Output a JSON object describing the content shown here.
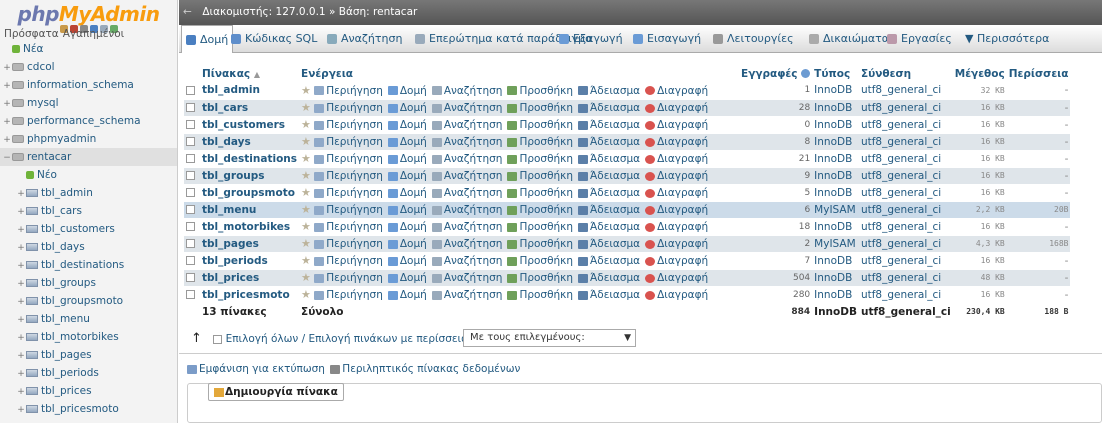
{
  "brand": {
    "part1": "php",
    "part2": "MyAdmin"
  },
  "left": {
    "recent_label": "Πρόσφατα",
    "fav_label": "Αγαπημένοι",
    "tree": [
      {
        "label": "Νέα",
        "type": "new",
        "indent": 0
      },
      {
        "label": "cdcol",
        "type": "db",
        "indent": 0
      },
      {
        "label": "information_schema",
        "type": "db",
        "indent": 0
      },
      {
        "label": "mysql",
        "type": "db",
        "indent": 0
      },
      {
        "label": "performance_schema",
        "type": "db",
        "indent": 0
      },
      {
        "label": "phpmyadmin",
        "type": "db",
        "indent": 0
      },
      {
        "label": "rentacar",
        "type": "db",
        "indent": 0,
        "open": true
      },
      {
        "label": "Νέο",
        "type": "new",
        "indent": 1
      },
      {
        "label": "tbl_admin",
        "type": "tb",
        "indent": 1
      },
      {
        "label": "tbl_cars",
        "type": "tb",
        "indent": 1
      },
      {
        "label": "tbl_customers",
        "type": "tb",
        "indent": 1
      },
      {
        "label": "tbl_days",
        "type": "tb",
        "indent": 1
      },
      {
        "label": "tbl_destinations",
        "type": "tb",
        "indent": 1
      },
      {
        "label": "tbl_groups",
        "type": "tb",
        "indent": 1
      },
      {
        "label": "tbl_groupsmoto",
        "type": "tb",
        "indent": 1
      },
      {
        "label": "tbl_menu",
        "type": "tb",
        "indent": 1
      },
      {
        "label": "tbl_motorbikes",
        "type": "tb",
        "indent": 1
      },
      {
        "label": "tbl_pages",
        "type": "tb",
        "indent": 1
      },
      {
        "label": "tbl_periods",
        "type": "tb",
        "indent": 1
      },
      {
        "label": "tbl_prices",
        "type": "tb",
        "indent": 1
      },
      {
        "label": "tbl_pricesmoto",
        "type": "tb",
        "indent": 1
      }
    ]
  },
  "topbar": {
    "server": "Διακομιστής: 127.0.0.1",
    "sep": "»",
    "db": "Βάση: rentacar"
  },
  "tabs": [
    {
      "label": "Δομή",
      "icon_color": "#4a7fc1"
    },
    {
      "label": "Κώδικας SQL",
      "icon_color": "#5e8ecb"
    },
    {
      "label": "Αναζήτηση",
      "icon_color": "#8ab"
    },
    {
      "label": "Επερώτημα κατά παράδειγμα",
      "icon_color": "#9ab"
    },
    {
      "label": "Εξαγωγή",
      "icon_color": "#6a9bd6"
    },
    {
      "label": "Εισαγωγή",
      "icon_color": "#6a9bd6"
    },
    {
      "label": "Λειτουργίες",
      "icon_color": "#999"
    },
    {
      "label": "Δικαιώματα",
      "icon_color": "#aaa"
    },
    {
      "label": "Εργασίες",
      "icon_color": "#b9a"
    },
    {
      "label": "▼ Περισσότερα",
      "icon_color": ""
    }
  ],
  "table": {
    "headers": {
      "table": "Πίνακας",
      "sort": "▲",
      "action": "Ενέργεια",
      "rows": "Εγγραφές",
      "type": "Τύπος",
      "collation": "Σύνθεση",
      "size": "Μέγεθος",
      "overhead": "Περίσσεια"
    },
    "actions": {
      "browse": "Περιήγηση",
      "structure": "Δομή",
      "search": "Αναζήτηση",
      "insert": "Προσθήκη",
      "empty": "Άδειασμα",
      "drop": "Διαγραφή"
    },
    "rows": [
      {
        "name": "tbl_admin",
        "rows": "1",
        "type": "InnoDB",
        "collation": "utf8_general_ci",
        "size": "32 KB",
        "overhead": "-"
      },
      {
        "name": "tbl_cars",
        "rows": "28",
        "type": "InnoDB",
        "collation": "utf8_general_ci",
        "size": "16 KB",
        "overhead": "-"
      },
      {
        "name": "tbl_customers",
        "rows": "0",
        "type": "InnoDB",
        "collation": "utf8_general_ci",
        "size": "16 KB",
        "overhead": "-"
      },
      {
        "name": "tbl_days",
        "rows": "8",
        "type": "InnoDB",
        "collation": "utf8_general_ci",
        "size": "16 KB",
        "overhead": "-"
      },
      {
        "name": "tbl_destinations",
        "rows": "21",
        "type": "InnoDB",
        "collation": "utf8_general_ci",
        "size": "16 KB",
        "overhead": "-"
      },
      {
        "name": "tbl_groups",
        "rows": "9",
        "type": "InnoDB",
        "collation": "utf8_general_ci",
        "size": "16 KB",
        "overhead": "-"
      },
      {
        "name": "tbl_groupsmoto",
        "rows": "5",
        "type": "InnoDB",
        "collation": "utf8_general_ci",
        "size": "16 KB",
        "overhead": "-"
      },
      {
        "name": "tbl_menu",
        "rows": "6",
        "type": "MyISAM",
        "collation": "utf8_general_ci",
        "size": "2,2 KB",
        "overhead": "20B",
        "highlight": true
      },
      {
        "name": "tbl_motorbikes",
        "rows": "18",
        "type": "InnoDB",
        "collation": "utf8_general_ci",
        "size": "16 KB",
        "overhead": "-"
      },
      {
        "name": "tbl_pages",
        "rows": "2",
        "type": "MyISAM",
        "collation": "utf8_general_ci",
        "size": "4,3 KB",
        "overhead": "168B"
      },
      {
        "name": "tbl_periods",
        "rows": "7",
        "type": "InnoDB",
        "collation": "utf8_general_ci",
        "size": "16 KB",
        "overhead": "-"
      },
      {
        "name": "tbl_prices",
        "rows": "504",
        "type": "InnoDB",
        "collation": "utf8_general_ci",
        "size": "48 KB",
        "overhead": "-"
      },
      {
        "name": "tbl_pricesmoto",
        "rows": "280",
        "type": "InnoDB",
        "collation": "utf8_general_ci",
        "size": "16 KB",
        "overhead": "-"
      }
    ],
    "footer": {
      "count": "13 πίνακες",
      "sum": "Σύνολο",
      "rows": "884",
      "type": "InnoDB",
      "collation": "utf8_general_ci",
      "size": "230,4 KB",
      "overhead": "188 B"
    }
  },
  "bulk": {
    "check_all": "Επιλογή όλων / Επιλογή πινάκων με περίσσεια",
    "with_selected": "Με τους επιλεγμένους:"
  },
  "links": {
    "print": "Εμφάνιση για εκτύπωση",
    "dict": "Περιληπτικός πίνακας δεδομένων"
  },
  "create": {
    "legend": "Δημιουργία πίνακα"
  }
}
